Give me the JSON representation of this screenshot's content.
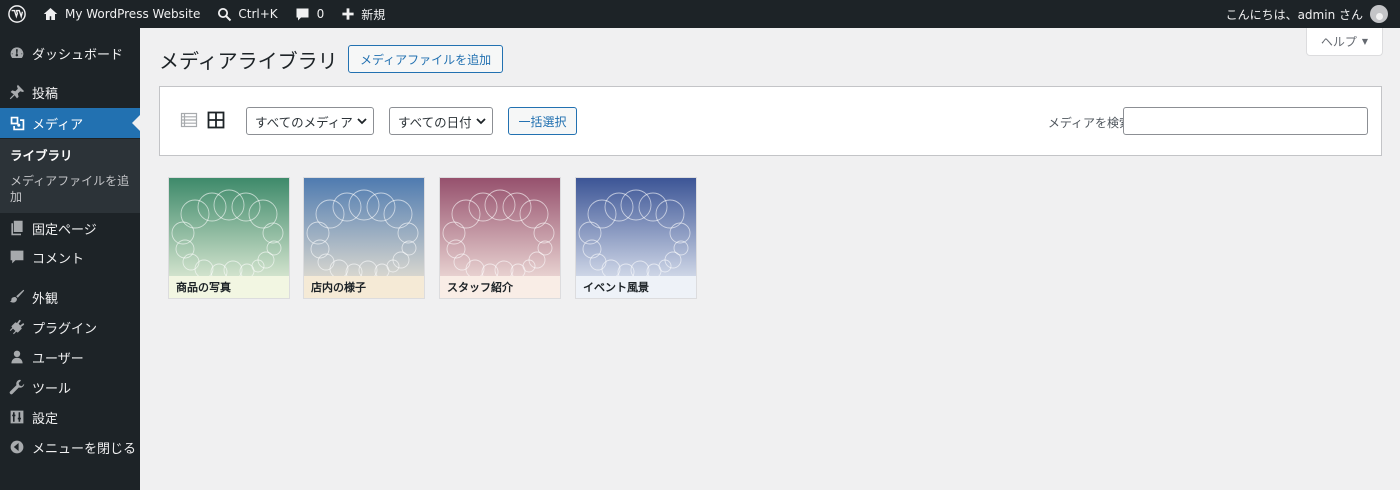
{
  "adminbar": {
    "site_name": "My WordPress Website",
    "shortcut": "Ctrl+K",
    "comment_count": "0",
    "new_label": "新規",
    "greeting": "こんにちは、admin さん"
  },
  "sidebar": {
    "items": [
      {
        "label": "ダッシュボード",
        "icon": "dashboard-icon"
      },
      {
        "label": "投稿",
        "icon": "pin-icon"
      },
      {
        "label": "メディア",
        "icon": "media-icon"
      },
      {
        "label": "固定ページ",
        "icon": "pages-icon"
      },
      {
        "label": "コメント",
        "icon": "comment-icon"
      },
      {
        "label": "外観",
        "icon": "brush-icon"
      },
      {
        "label": "プラグイン",
        "icon": "plugin-icon"
      },
      {
        "label": "ユーザー",
        "icon": "user-icon"
      },
      {
        "label": "ツール",
        "icon": "wrench-icon"
      },
      {
        "label": "設定",
        "icon": "settings-icon"
      },
      {
        "label": "メニューを閉じる",
        "icon": "collapse-icon"
      }
    ],
    "submenu": {
      "library": "ライブラリ",
      "add_new_line1": "メディアファイルを追",
      "add_new_line2": "加"
    }
  },
  "main": {
    "title": "メディアライブラリ",
    "add_button": "メディアファイルを追加",
    "help_label": "ヘルプ",
    "filters": {
      "media_type": "すべてのメディア",
      "date": "すべての日付",
      "bulk_select": "一括選択"
    },
    "search": {
      "label": "メディアを検索",
      "value": ""
    },
    "attachments": [
      {
        "caption": "商品の写真",
        "color_top": "#3e8a6a",
        "color_bottom": "#f2f6e2"
      },
      {
        "caption": "店内の様子",
        "color_top": "#4f7bb0",
        "color_bottom": "#f5ead6"
      },
      {
        "caption": "スタッフ紹介",
        "color_top": "#96516d",
        "color_bottom": "#f9ede6"
      },
      {
        "caption": "イベント風景",
        "color_top": "#3c5596",
        "color_bottom": "#eef2f8"
      }
    ]
  },
  "colors": {
    "admin_dark": "#1d2327",
    "accent": "#2271b1",
    "background": "#f0f0f1"
  }
}
